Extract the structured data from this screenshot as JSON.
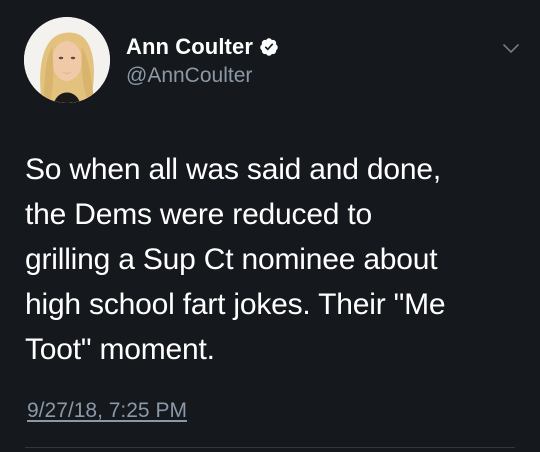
{
  "author": {
    "display_name": "Ann Coulter",
    "handle": "@AnnCoulter",
    "verified": true
  },
  "tweet": {
    "text": "So when all was said and done,\nthe Dems were reduced to\ngrilling a Sup Ct nominee about\nhigh school fart jokes. Their \"Me\nToot\" moment.",
    "timestamp": "9/27/18, 7:25 PM"
  },
  "icons": {
    "verified": "verified-badge-icon",
    "menu": "chevron-down-icon"
  },
  "colors": {
    "background": "#15181d",
    "text_primary": "#ffffff",
    "text_secondary": "#8b98a5",
    "verified_badge": "#ffffff"
  }
}
